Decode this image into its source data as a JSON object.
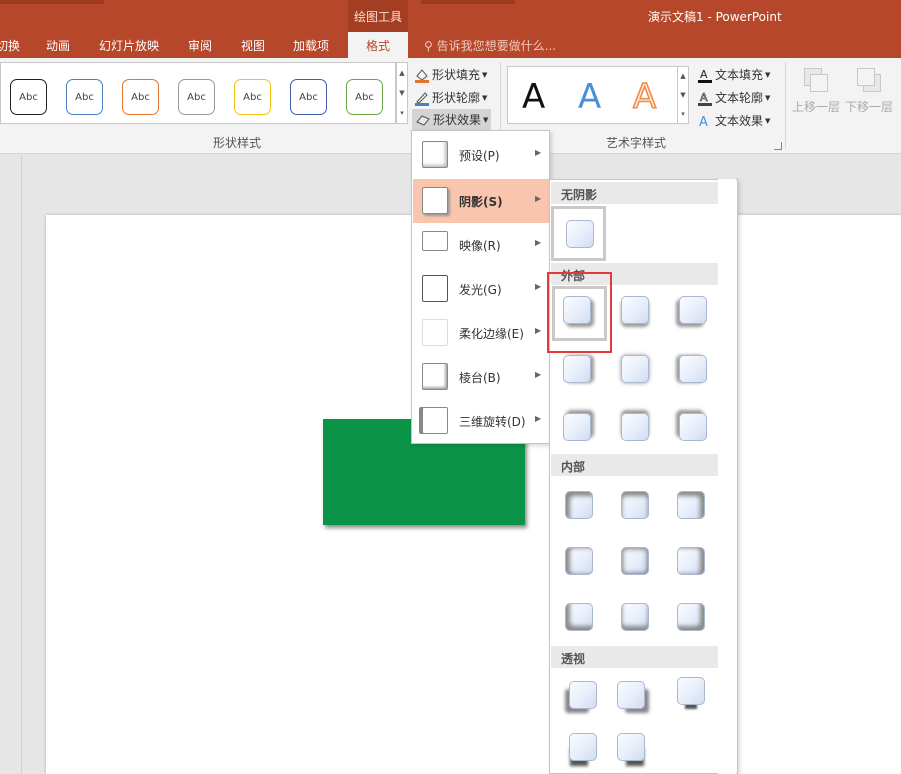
{
  "window": {
    "contextual_group": "绘图工具",
    "title": "演示文稿1 - PowerPoint"
  },
  "tabs": [
    {
      "label": "切换"
    },
    {
      "label": "动画"
    },
    {
      "label": "幻灯片放映"
    },
    {
      "label": "审阅"
    },
    {
      "label": "视图"
    },
    {
      "label": "加载项"
    },
    {
      "label": "格式",
      "active": true
    }
  ],
  "tell_me": "告诉我您想要做什么...",
  "shape_styles": {
    "group_label": "形状样式",
    "thumbnails": [
      {
        "label": "Abc",
        "color": "#1f1f1f"
      },
      {
        "label": "Abc",
        "color": "#4a7fc1"
      },
      {
        "label": "Abc",
        "color": "#e2732d"
      },
      {
        "label": "Abc",
        "color": "#9a9a9a"
      },
      {
        "label": "Abc",
        "color": "#f2c314"
      },
      {
        "label": "Abc",
        "color": "#3d5fa8"
      },
      {
        "label": "Abc",
        "color": "#6aa743"
      }
    ],
    "fill": "形状填充",
    "outline": "形状轮廓",
    "effects": "形状效果"
  },
  "wordart": {
    "group_label": "艺术字样式",
    "samples": [
      {
        "letter": "A",
        "color": "#111111"
      },
      {
        "letter": "A",
        "color": "#4a90d9"
      },
      {
        "letter": "A",
        "color": "#f5a46a"
      }
    ],
    "text_fill": "文本填充",
    "text_outline": "文本轮廓",
    "text_effects": "文本效果"
  },
  "arrange": {
    "bring_forward": "上移一层",
    "send_backward": "下移一层"
  },
  "effects_menu": {
    "items": [
      {
        "label": "预设(P)"
      },
      {
        "label": "阴影(S)",
        "active": true
      },
      {
        "label": "映像(R)"
      },
      {
        "label": "发光(G)"
      },
      {
        "label": "柔化边缘(E)"
      },
      {
        "label": "棱台(B)"
      },
      {
        "label": "三维旋转(D)"
      }
    ]
  },
  "shadow_submenu": {
    "no_shadow": "无阴影",
    "outer": "外部",
    "inner": "内部",
    "perspective": "透视"
  },
  "colors": {
    "accent": "#b7472a",
    "shape_fill": "#0b9447",
    "hover": "#f9c5ad",
    "highlight_box": "#e03a3a"
  }
}
